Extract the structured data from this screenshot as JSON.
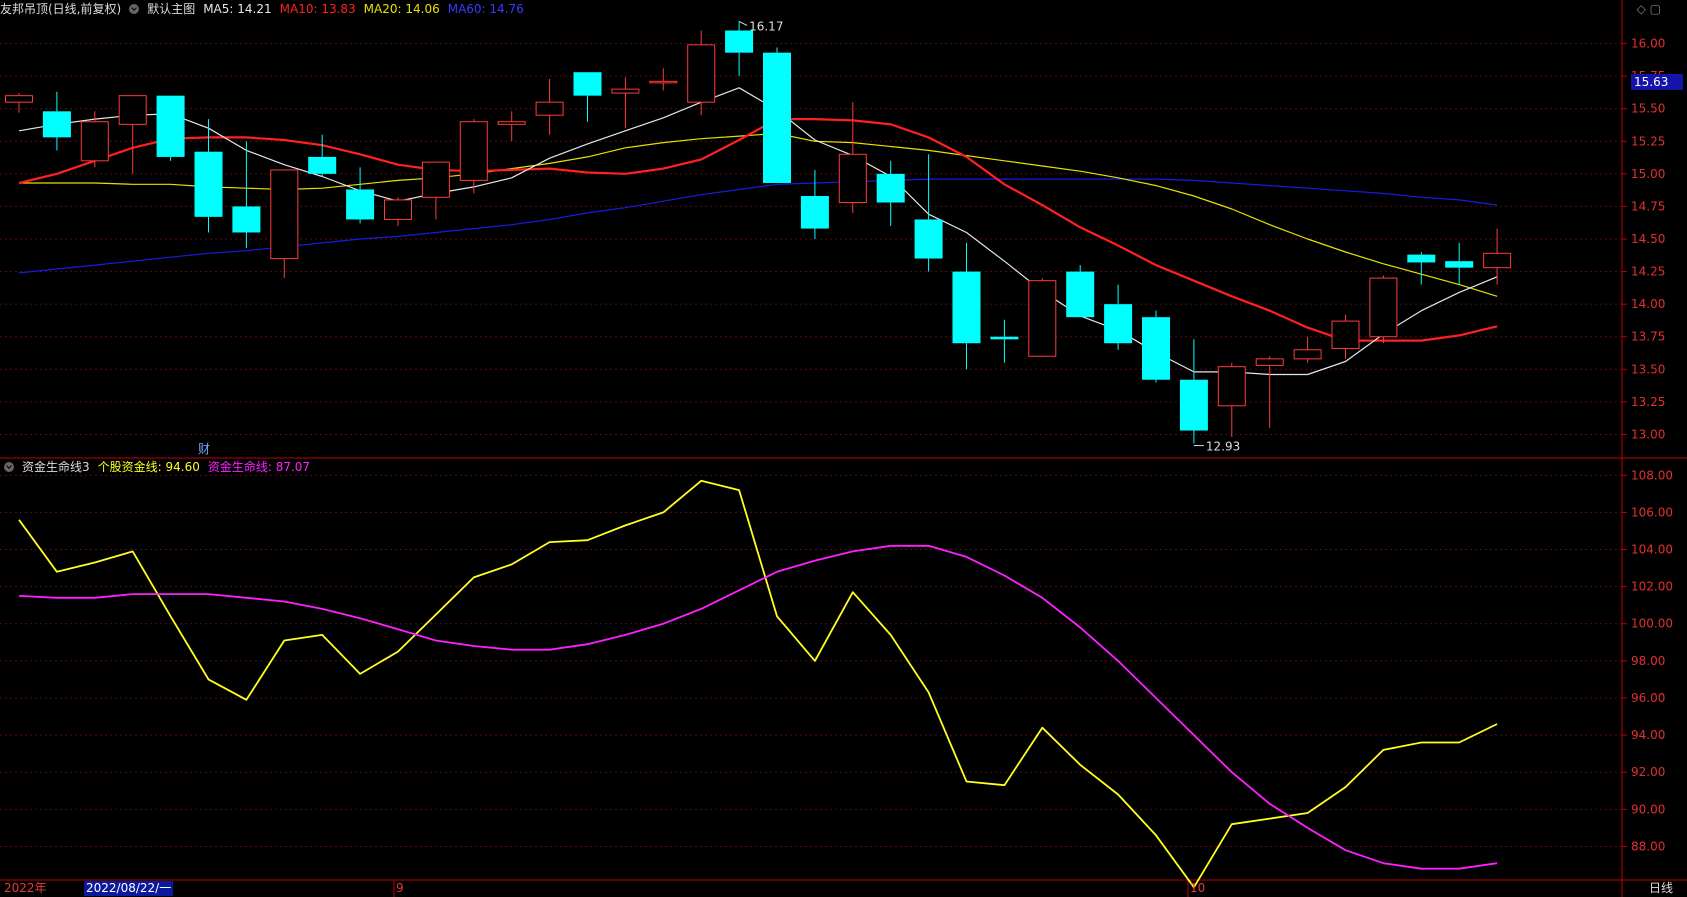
{
  "header": {
    "main_title": "友邦吊顶(日线,前复权)",
    "default_label": "默认主图",
    "ma5": "MA5: 14.21",
    "ma10": "MA10: 13.83",
    "ma20": "MA20: 14.06",
    "ma60": "MA60: 14.76",
    "indicator_title": "资金生命线3",
    "stock_line": "个股资金线: 94.60",
    "life_line": "资金生命线: 87.07"
  },
  "colors": {
    "up": "#ff3a3a",
    "down": "#00ffff",
    "ma5": "#e6e6e6",
    "ma10": "#ff2020",
    "ma20": "#e8e000",
    "ma60": "#1a1ae6",
    "stock_line": "#ffff20",
    "life_line": "#ff20ff",
    "grid": "#5a0d0d",
    "axis": "#c00000"
  },
  "top_icons": "◇ ▢",
  "price_tag": "15.63",
  "cai_label": "财",
  "high_label": "16.17",
  "low_label": "12.93",
  "date_axis": {
    "year": "2022年",
    "cursor_date": "2022/08/22/一",
    "months": [
      "9",
      "10"
    ]
  },
  "bottom_right": "日线",
  "chart_data": [
    {
      "type": "candlestick",
      "title": "友邦吊顶(日线,前复权)",
      "ylim": [
        12.85,
        16.15
      ],
      "y_ticks": [
        "13.00",
        "13.25",
        "13.50",
        "13.75",
        "14.00",
        "14.25",
        "14.50",
        "14.75",
        "15.00",
        "15.25",
        "15.50",
        "15.75",
        "16.00"
      ],
      "candles": [
        {
          "o": 15.55,
          "h": 15.62,
          "l": 15.47,
          "c": 15.6
        },
        {
          "o": 15.48,
          "h": 15.63,
          "l": 15.18,
          "c": 15.28
        },
        {
          "o": 15.1,
          "h": 15.48,
          "l": 15.05,
          "c": 15.4
        },
        {
          "o": 15.38,
          "h": 15.6,
          "l": 15.0,
          "c": 15.6
        },
        {
          "o": 15.6,
          "h": 15.6,
          "l": 15.1,
          "c": 15.13
        },
        {
          "o": 15.17,
          "h": 15.42,
          "l": 14.55,
          "c": 14.67
        },
        {
          "o": 14.75,
          "h": 15.25,
          "l": 14.43,
          "c": 14.55
        },
        {
          "o": 14.35,
          "h": 15.02,
          "l": 14.2,
          "c": 15.03
        },
        {
          "o": 15.13,
          "h": 15.3,
          "l": 14.98,
          "c": 15.0
        },
        {
          "o": 14.88,
          "h": 15.05,
          "l": 14.62,
          "c": 14.65
        },
        {
          "o": 14.65,
          "h": 14.82,
          "l": 14.6,
          "c": 14.8
        },
        {
          "o": 14.82,
          "h": 15.05,
          "l": 14.65,
          "c": 15.09
        },
        {
          "o": 14.95,
          "h": 15.42,
          "l": 14.85,
          "c": 15.4
        },
        {
          "o": 15.38,
          "h": 15.48,
          "l": 15.25,
          "c": 15.4
        },
        {
          "o": 15.45,
          "h": 15.73,
          "l": 15.3,
          "c": 15.55
        },
        {
          "o": 15.78,
          "h": 15.78,
          "l": 15.4,
          "c": 15.6
        },
        {
          "o": 15.62,
          "h": 15.74,
          "l": 15.35,
          "c": 15.65
        },
        {
          "o": 15.71,
          "h": 15.81,
          "l": 15.64,
          "c": 15.71
        },
        {
          "o": 15.55,
          "h": 16.1,
          "l": 15.45,
          "c": 15.99
        },
        {
          "o": 16.1,
          "h": 16.17,
          "l": 15.75,
          "c": 15.93
        },
        {
          "o": 15.93,
          "h": 15.97,
          "l": 14.95,
          "c": 14.93
        },
        {
          "o": 14.83,
          "h": 15.03,
          "l": 14.5,
          "c": 14.58
        },
        {
          "o": 14.78,
          "h": 15.55,
          "l": 14.7,
          "c": 15.15
        },
        {
          "o": 15.0,
          "h": 15.1,
          "l": 14.6,
          "c": 14.78
        },
        {
          "o": 14.65,
          "h": 15.15,
          "l": 14.25,
          "c": 14.35
        },
        {
          "o": 14.25,
          "h": 14.47,
          "l": 13.5,
          "c": 13.7
        },
        {
          "o": 13.75,
          "h": 13.88,
          "l": 13.55,
          "c": 13.73
        },
        {
          "o": 13.6,
          "h": 14.2,
          "l": 13.6,
          "c": 14.18
        },
        {
          "o": 14.25,
          "h": 14.3,
          "l": 13.9,
          "c": 13.9
        },
        {
          "o": 14.0,
          "h": 14.15,
          "l": 13.65,
          "c": 13.7
        },
        {
          "o": 13.9,
          "h": 13.95,
          "l": 13.4,
          "c": 13.42
        },
        {
          "o": 13.42,
          "h": 13.73,
          "l": 12.93,
          "c": 13.03
        },
        {
          "o": 13.22,
          "h": 13.55,
          "l": 12.98,
          "c": 13.52
        },
        {
          "o": 13.53,
          "h": 13.6,
          "l": 13.05,
          "c": 13.58
        },
        {
          "o": 13.58,
          "h": 13.75,
          "l": 13.55,
          "c": 13.65
        },
        {
          "o": 13.66,
          "h": 13.92,
          "l": 13.58,
          "c": 13.87
        },
        {
          "o": 13.75,
          "h": 14.22,
          "l": 13.7,
          "c": 14.2
        },
        {
          "o": 14.38,
          "h": 14.4,
          "l": 14.15,
          "c": 14.32
        },
        {
          "o": 14.33,
          "h": 14.47,
          "l": 14.15,
          "c": 14.28
        },
        {
          "o": 14.28,
          "h": 14.58,
          "l": 14.15,
          "c": 14.39
        }
      ],
      "ma5": [
        15.33,
        15.38,
        15.42,
        15.45,
        15.46,
        15.35,
        15.18,
        15.07,
        14.98,
        14.87,
        14.79,
        14.85,
        14.9,
        14.97,
        15.12,
        15.23,
        15.33,
        15.43,
        15.55,
        15.66,
        15.49,
        15.26,
        15.14,
        14.98,
        14.69,
        14.55,
        14.33,
        14.1,
        13.91,
        13.8,
        13.63,
        13.48,
        13.48,
        13.46,
        13.46,
        13.56,
        13.77,
        13.95,
        14.09,
        14.21
      ],
      "ma10": [
        14.93,
        15.0,
        15.1,
        15.2,
        15.27,
        15.28,
        15.28,
        15.26,
        15.22,
        15.15,
        15.07,
        15.03,
        15.02,
        15.03,
        15.04,
        15.01,
        15.0,
        15.04,
        15.11,
        15.26,
        15.42,
        15.42,
        15.41,
        15.38,
        15.28,
        15.13,
        14.92,
        14.76,
        14.59,
        14.45,
        14.3,
        14.18,
        14.06,
        13.95,
        13.82,
        13.72,
        13.72,
        13.72,
        13.76,
        13.83
      ],
      "ma20": [
        14.93,
        14.93,
        14.93,
        14.92,
        14.92,
        14.9,
        14.89,
        14.88,
        14.89,
        14.92,
        14.95,
        14.97,
        15.0,
        15.04,
        15.08,
        15.13,
        15.2,
        15.24,
        15.27,
        15.29,
        15.31,
        15.25,
        15.24,
        15.21,
        15.18,
        15.14,
        15.1,
        15.06,
        15.02,
        14.97,
        14.91,
        14.83,
        14.73,
        14.61,
        14.5,
        14.4,
        14.31,
        14.23,
        14.15,
        14.06
      ],
      "ma60": [
        14.24,
        14.27,
        14.3,
        14.33,
        14.36,
        14.39,
        14.41,
        14.44,
        14.47,
        14.5,
        14.52,
        14.55,
        14.58,
        14.61,
        14.65,
        14.7,
        14.74,
        14.79,
        14.84,
        14.88,
        14.92,
        14.93,
        14.94,
        14.95,
        14.96,
        14.96,
        14.96,
        14.96,
        14.96,
        14.96,
        14.96,
        14.95,
        14.93,
        14.91,
        14.89,
        14.87,
        14.85,
        14.82,
        14.8,
        14.76
      ]
    },
    {
      "type": "line",
      "title": "资金生命线3",
      "ylim": [
        86.3,
        108.5
      ],
      "y_ticks": [
        "88.00",
        "90.00",
        "92.00",
        "94.00",
        "96.00",
        "98.00",
        "100.00",
        "102.00",
        "104.00",
        "106.00",
        "108.00"
      ],
      "series": [
        {
          "name": "个股资金线",
          "values": [
            105.6,
            102.8,
            103.3,
            103.9,
            100.4,
            97.0,
            95.9,
            99.1,
            99.4,
            97.3,
            98.5,
            100.5,
            102.5,
            103.2,
            104.4,
            104.5,
            105.3,
            106.0,
            107.7,
            107.2,
            100.4,
            98.0,
            101.7,
            99.4,
            96.3,
            91.5,
            91.3,
            94.4,
            92.4,
            90.8,
            88.6,
            85.8,
            89.2,
            89.5,
            89.8,
            91.2,
            93.2,
            93.6,
            93.6,
            94.6
          ]
        },
        {
          "name": "资金生命线",
          "values": [
            101.5,
            101.4,
            101.4,
            101.6,
            101.6,
            101.6,
            101.4,
            101.2,
            100.8,
            100.3,
            99.7,
            99.1,
            98.8,
            98.6,
            98.6,
            98.9,
            99.4,
            100.0,
            100.8,
            101.8,
            102.8,
            103.4,
            103.9,
            104.2,
            104.2,
            103.6,
            102.6,
            101.4,
            99.8,
            98.0,
            96.0,
            94.0,
            92.0,
            90.3,
            89.0,
            87.8,
            87.1,
            86.8,
            86.8,
            87.1
          ]
        }
      ]
    }
  ]
}
